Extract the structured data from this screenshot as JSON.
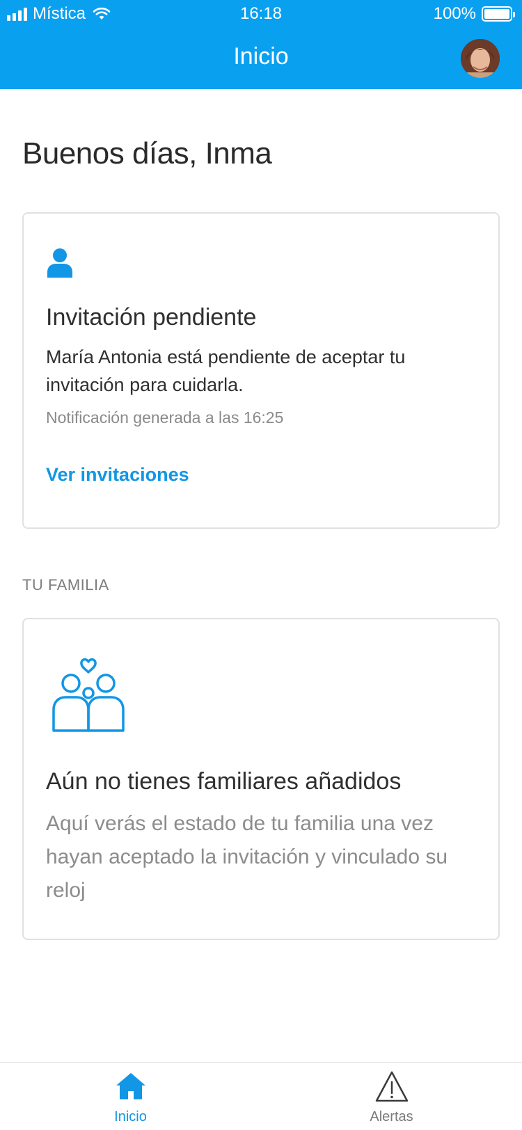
{
  "status_bar": {
    "carrier": "Mística",
    "time": "16:18",
    "battery": "100%"
  },
  "header": {
    "title": "Inicio",
    "avatar_icon": "user-avatar"
  },
  "greeting": "Buenos días, Inma",
  "invitation_card": {
    "icon": "person-icon",
    "title": "Invitación pendiente",
    "body": "María Antonia está pendiente de aceptar tu invitación para cuidarla.",
    "note": "Notificación generada a las 16:25",
    "link": "Ver invitaciones"
  },
  "family_section": {
    "label": "TU FAMILIA",
    "icon": "family-icon",
    "title": "Aún no tienes familiares añadidos",
    "body": "Aquí verás el estado de tu familia una vez hayan aceptado la invitación y vinculado su reloj"
  },
  "tabbar": {
    "tabs": [
      {
        "label": "Inicio",
        "icon": "home-icon",
        "active": true
      },
      {
        "label": "Alertas",
        "icon": "warning-icon",
        "active": false
      }
    ]
  },
  "colors": {
    "header": "#0aa0f0",
    "accent": "#1296e6"
  }
}
